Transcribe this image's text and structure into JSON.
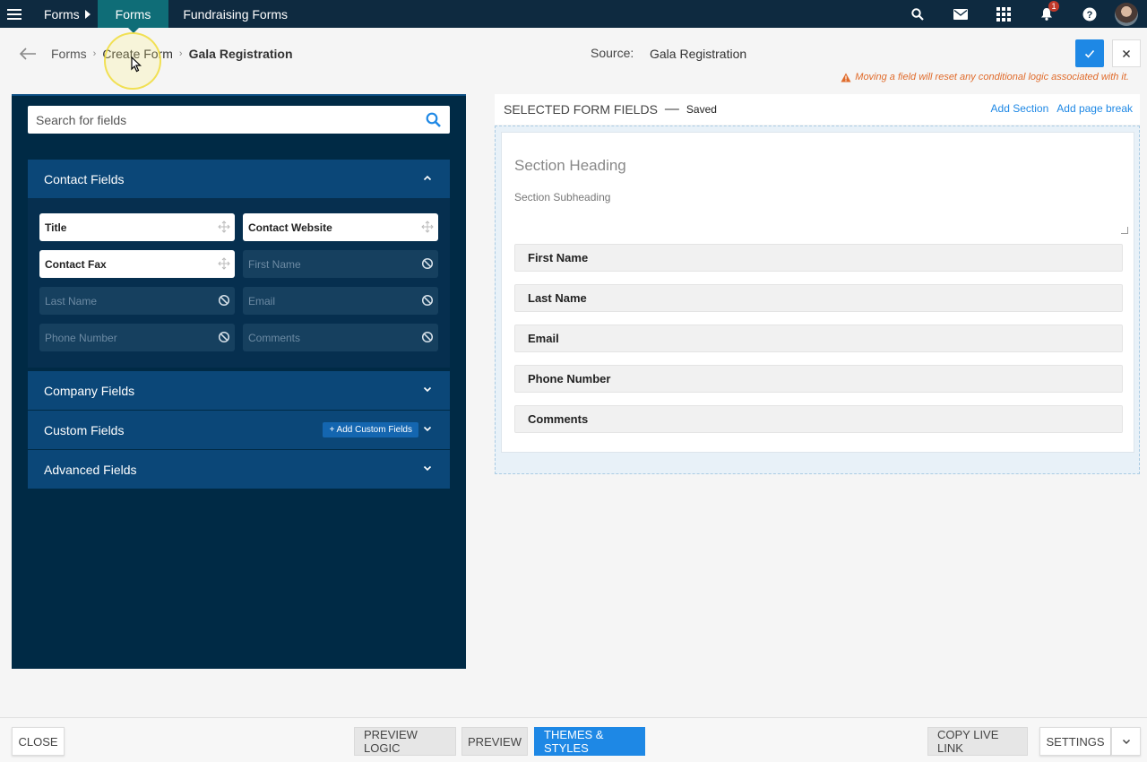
{
  "topbar": {
    "parent_label": "Forms",
    "tabs": [
      {
        "label": "Forms",
        "active": true
      },
      {
        "label": "Fundraising Forms",
        "active": false
      }
    ],
    "notification_count": "1",
    "colors": {
      "bar": "#0e2a40",
      "active_tab": "#0f6d77"
    }
  },
  "breadcrumb": {
    "items": [
      "Forms",
      "Create Form"
    ],
    "current": "Gala Registration"
  },
  "source": {
    "label": "Source:",
    "value": "Gala Registration"
  },
  "warning_text": "Moving a field will reset any conditional logic associated with it.",
  "field_search": {
    "placeholder": "Search for fields"
  },
  "sections": {
    "contact": {
      "label": "Contact Fields",
      "fields": [
        {
          "label": "Title",
          "available": true
        },
        {
          "label": "Contact Website",
          "available": true
        },
        {
          "label": "Contact Fax",
          "available": true
        },
        {
          "label": "First Name",
          "available": false
        },
        {
          "label": "Last Name",
          "available": false
        },
        {
          "label": "Email",
          "available": false
        },
        {
          "label": "Phone Number",
          "available": false
        },
        {
          "label": "Comments",
          "available": false
        }
      ]
    },
    "company": {
      "label": "Company Fields"
    },
    "custom": {
      "label": "Custom Fields",
      "add_label": "+ Add Custom Fields"
    },
    "advanced": {
      "label": "Advanced Fields"
    }
  },
  "selected": {
    "title": "SELECTED FORM FIELDS",
    "dash": "—",
    "status": "Saved",
    "add_section": "Add Section",
    "add_page_break": "Add page break",
    "section_heading": "Section Heading",
    "section_subheading": "Section Subheading",
    "fields": [
      "First Name",
      "Last Name",
      "Email",
      "Phone Number",
      "Comments"
    ]
  },
  "bottombar": {
    "close": "CLOSE",
    "preview_logic": "PREVIEW LOGIC",
    "preview": "PREVIEW",
    "themes": "THEMES & STYLES",
    "copy_link": "COPY LIVE LINK",
    "settings": "SETTINGS"
  },
  "icons": {
    "menu": "hamburger-icon",
    "search": "search-icon",
    "mail": "mail-icon",
    "apps": "grid-icon",
    "bell": "bell-icon",
    "help": "help-icon",
    "drag": "move-icon",
    "disabled": "ban-icon"
  }
}
